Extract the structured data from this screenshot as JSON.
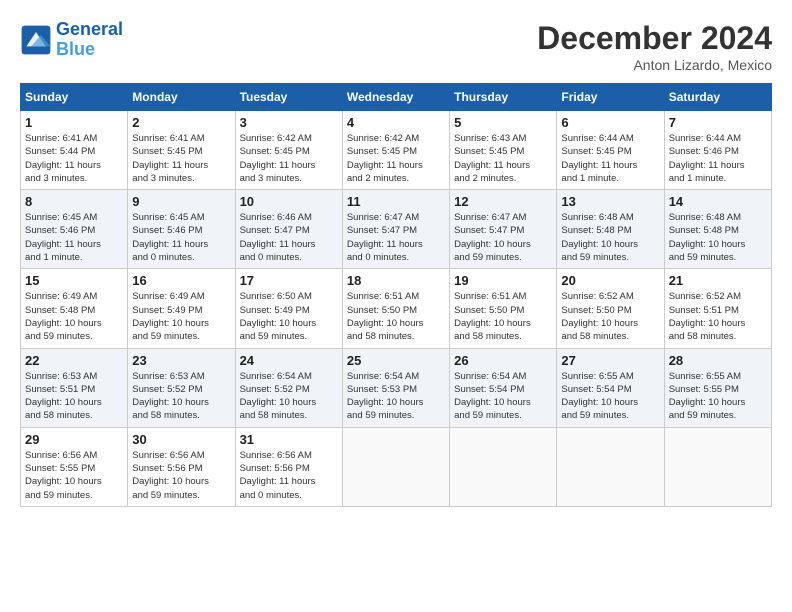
{
  "header": {
    "logo_line1": "General",
    "logo_line2": "Blue",
    "month": "December 2024",
    "location": "Anton Lizardo, Mexico"
  },
  "weekdays": [
    "Sunday",
    "Monday",
    "Tuesday",
    "Wednesday",
    "Thursday",
    "Friday",
    "Saturday"
  ],
  "weeks": [
    [
      {
        "day": "1",
        "info": "Sunrise: 6:41 AM\nSunset: 5:44 PM\nDaylight: 11 hours\nand 3 minutes."
      },
      {
        "day": "2",
        "info": "Sunrise: 6:41 AM\nSunset: 5:45 PM\nDaylight: 11 hours\nand 3 minutes."
      },
      {
        "day": "3",
        "info": "Sunrise: 6:42 AM\nSunset: 5:45 PM\nDaylight: 11 hours\nand 3 minutes."
      },
      {
        "day": "4",
        "info": "Sunrise: 6:42 AM\nSunset: 5:45 PM\nDaylight: 11 hours\nand 2 minutes."
      },
      {
        "day": "5",
        "info": "Sunrise: 6:43 AM\nSunset: 5:45 PM\nDaylight: 11 hours\nand 2 minutes."
      },
      {
        "day": "6",
        "info": "Sunrise: 6:44 AM\nSunset: 5:45 PM\nDaylight: 11 hours\nand 1 minute."
      },
      {
        "day": "7",
        "info": "Sunrise: 6:44 AM\nSunset: 5:46 PM\nDaylight: 11 hours\nand 1 minute."
      }
    ],
    [
      {
        "day": "8",
        "info": "Sunrise: 6:45 AM\nSunset: 5:46 PM\nDaylight: 11 hours\nand 1 minute."
      },
      {
        "day": "9",
        "info": "Sunrise: 6:45 AM\nSunset: 5:46 PM\nDaylight: 11 hours\nand 0 minutes."
      },
      {
        "day": "10",
        "info": "Sunrise: 6:46 AM\nSunset: 5:47 PM\nDaylight: 11 hours\nand 0 minutes."
      },
      {
        "day": "11",
        "info": "Sunrise: 6:47 AM\nSunset: 5:47 PM\nDaylight: 11 hours\nand 0 minutes."
      },
      {
        "day": "12",
        "info": "Sunrise: 6:47 AM\nSunset: 5:47 PM\nDaylight: 10 hours\nand 59 minutes."
      },
      {
        "day": "13",
        "info": "Sunrise: 6:48 AM\nSunset: 5:48 PM\nDaylight: 10 hours\nand 59 minutes."
      },
      {
        "day": "14",
        "info": "Sunrise: 6:48 AM\nSunset: 5:48 PM\nDaylight: 10 hours\nand 59 minutes."
      }
    ],
    [
      {
        "day": "15",
        "info": "Sunrise: 6:49 AM\nSunset: 5:48 PM\nDaylight: 10 hours\nand 59 minutes."
      },
      {
        "day": "16",
        "info": "Sunrise: 6:49 AM\nSunset: 5:49 PM\nDaylight: 10 hours\nand 59 minutes."
      },
      {
        "day": "17",
        "info": "Sunrise: 6:50 AM\nSunset: 5:49 PM\nDaylight: 10 hours\nand 59 minutes."
      },
      {
        "day": "18",
        "info": "Sunrise: 6:51 AM\nSunset: 5:50 PM\nDaylight: 10 hours\nand 58 minutes."
      },
      {
        "day": "19",
        "info": "Sunrise: 6:51 AM\nSunset: 5:50 PM\nDaylight: 10 hours\nand 58 minutes."
      },
      {
        "day": "20",
        "info": "Sunrise: 6:52 AM\nSunset: 5:50 PM\nDaylight: 10 hours\nand 58 minutes."
      },
      {
        "day": "21",
        "info": "Sunrise: 6:52 AM\nSunset: 5:51 PM\nDaylight: 10 hours\nand 58 minutes."
      }
    ],
    [
      {
        "day": "22",
        "info": "Sunrise: 6:53 AM\nSunset: 5:51 PM\nDaylight: 10 hours\nand 58 minutes."
      },
      {
        "day": "23",
        "info": "Sunrise: 6:53 AM\nSunset: 5:52 PM\nDaylight: 10 hours\nand 58 minutes."
      },
      {
        "day": "24",
        "info": "Sunrise: 6:54 AM\nSunset: 5:52 PM\nDaylight: 10 hours\nand 58 minutes."
      },
      {
        "day": "25",
        "info": "Sunrise: 6:54 AM\nSunset: 5:53 PM\nDaylight: 10 hours\nand 59 minutes."
      },
      {
        "day": "26",
        "info": "Sunrise: 6:54 AM\nSunset: 5:54 PM\nDaylight: 10 hours\nand 59 minutes."
      },
      {
        "day": "27",
        "info": "Sunrise: 6:55 AM\nSunset: 5:54 PM\nDaylight: 10 hours\nand 59 minutes."
      },
      {
        "day": "28",
        "info": "Sunrise: 6:55 AM\nSunset: 5:55 PM\nDaylight: 10 hours\nand 59 minutes."
      }
    ],
    [
      {
        "day": "29",
        "info": "Sunrise: 6:56 AM\nSunset: 5:55 PM\nDaylight: 10 hours\nand 59 minutes."
      },
      {
        "day": "30",
        "info": "Sunrise: 6:56 AM\nSunset: 5:56 PM\nDaylight: 10 hours\nand 59 minutes."
      },
      {
        "day": "31",
        "info": "Sunrise: 6:56 AM\nSunset: 5:56 PM\nDaylight: 11 hours\nand 0 minutes."
      },
      {
        "day": "",
        "info": ""
      },
      {
        "day": "",
        "info": ""
      },
      {
        "day": "",
        "info": ""
      },
      {
        "day": "",
        "info": ""
      }
    ]
  ]
}
